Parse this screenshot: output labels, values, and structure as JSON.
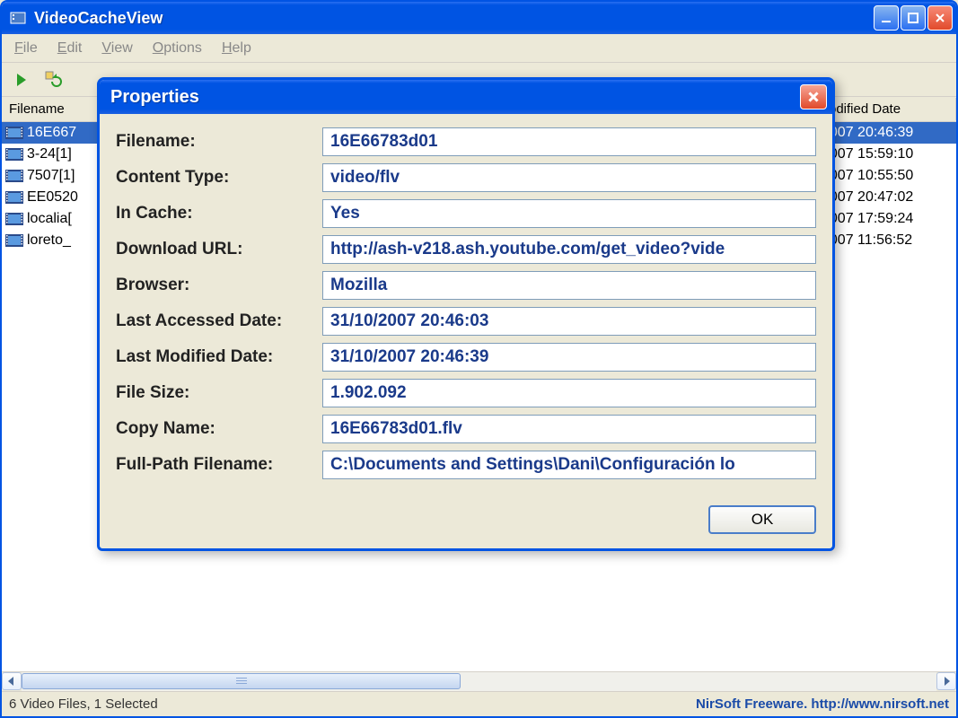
{
  "app": {
    "title": "VideoCacheView"
  },
  "menu": {
    "file": "File",
    "edit": "Edit",
    "view": "View",
    "options": "Options",
    "help": "Help"
  },
  "list": {
    "headers": {
      "filename": "Filename",
      "modified": "odified Date"
    },
    "rows": [
      {
        "filename": "16E667",
        "modified": "2007 20:46:39",
        "selected": true
      },
      {
        "filename": "3-24[1]",
        "modified": "2007 15:59:10",
        "selected": false
      },
      {
        "filename": "7507[1]",
        "modified": "2007 10:55:50",
        "selected": false
      },
      {
        "filename": "EE0520",
        "modified": "2007 20:47:02",
        "selected": false
      },
      {
        "filename": "localia[",
        "modified": "2007 17:59:24",
        "selected": false
      },
      {
        "filename": "loreto_",
        "modified": "2007 11:56:52",
        "selected": false
      }
    ]
  },
  "dialog": {
    "title": "Properties",
    "ok": "OK",
    "props": {
      "filename_label": "Filename:",
      "filename_value": "16E66783d01",
      "contenttype_label": "Content Type:",
      "contenttype_value": "video/flv",
      "incache_label": "In Cache:",
      "incache_value": "Yes",
      "url_label": "Download URL:",
      "url_value": "http://ash-v218.ash.youtube.com/get_video?vide",
      "browser_label": "Browser:",
      "browser_value": "Mozilla",
      "accessed_label": "Last Accessed Date:",
      "accessed_value": "31/10/2007 20:46:03",
      "modified_label": "Last Modified Date:",
      "modified_value": "31/10/2007 20:46:39",
      "filesize_label": "File Size:",
      "filesize_value": "1.902.092",
      "copyname_label": "Copy Name:",
      "copyname_value": "16E66783d01.flv",
      "fullpath_label": "Full-Path Filename:",
      "fullpath_value": "C:\\Documents and Settings\\Dani\\Configuración lo"
    }
  },
  "status": {
    "left": "6 Video Files, 1 Selected",
    "right": "NirSoft Freeware.  http://www.nirsoft.net"
  }
}
